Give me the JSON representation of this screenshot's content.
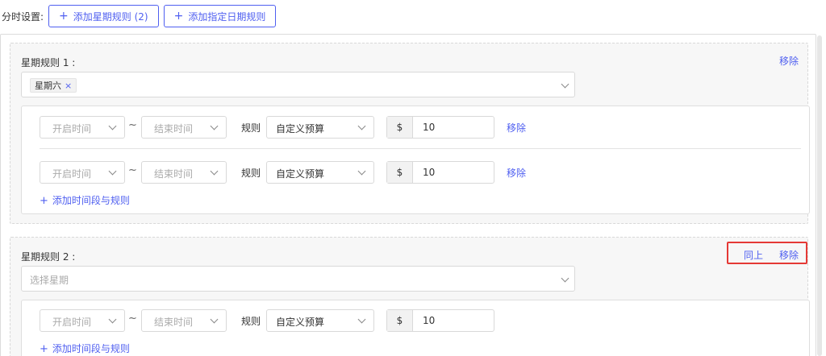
{
  "header": {
    "label": "分时设置:",
    "add_week_rule": "添加星期规则 (2)",
    "add_date_rule": "添加指定日期规则"
  },
  "rules": [
    {
      "title": "星期规则 1 :",
      "remove": "移除",
      "selected_day": "星期六",
      "rows": [
        {
          "start_placeholder": "开启时间",
          "tilde": "~",
          "end_placeholder": "结束时间",
          "rule_label": "规则",
          "budget": "自定义预算",
          "currency": "$",
          "amount": "10",
          "remove": "移除"
        },
        {
          "start_placeholder": "开启时间",
          "tilde": "~",
          "end_placeholder": "结束时间",
          "rule_label": "规则",
          "budget": "自定义预算",
          "currency": "$",
          "amount": "10",
          "remove": "移除"
        }
      ],
      "add_link": "添加时间段与规则"
    },
    {
      "title": "星期规则 2 :",
      "same_as_above": "同上",
      "remove": "移除",
      "day_placeholder": "选择星期",
      "rows": [
        {
          "start_placeholder": "开启时间",
          "tilde": "~",
          "end_placeholder": "结束时间",
          "rule_label": "规则",
          "budget": "自定义预算",
          "currency": "$",
          "amount": "10"
        }
      ],
      "add_link": "添加时间段与规则"
    }
  ],
  "colors": {
    "accent": "#4f5ff0",
    "highlight": "#e53935"
  }
}
